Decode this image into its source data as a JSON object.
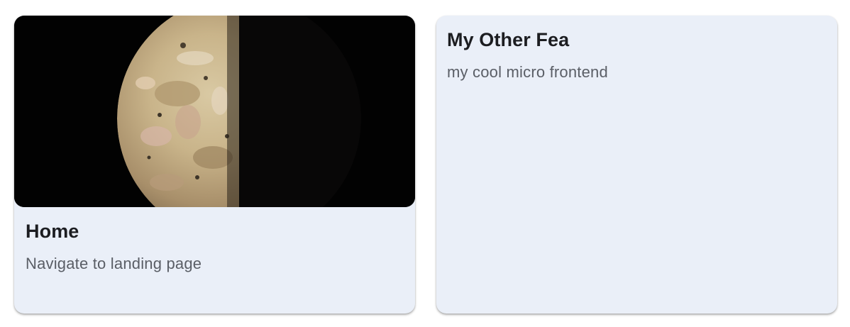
{
  "cards": [
    {
      "title": "Home",
      "subtitle": "Navigate to landing page",
      "image_icon": "moon-io-image"
    },
    {
      "title": "My Other Fea",
      "subtitle": "my cool micro frontend"
    }
  ],
  "colors": {
    "card_background": "#eaeff8",
    "title_text": "#1c1d21",
    "subtitle_text": "#5a5e66",
    "image_background": "#020202"
  }
}
